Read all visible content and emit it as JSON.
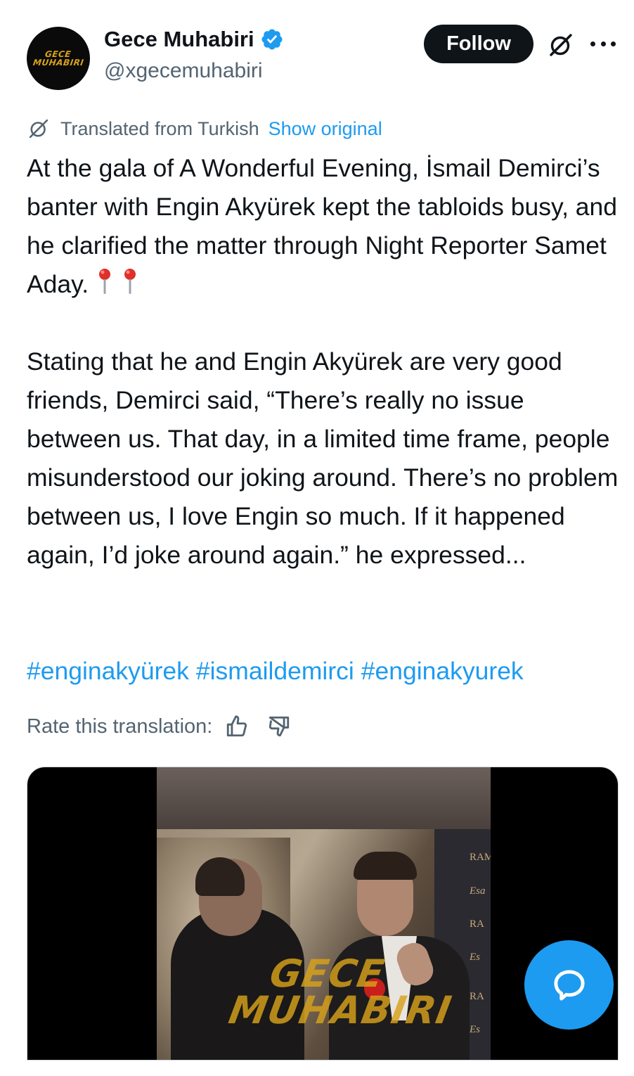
{
  "author": {
    "display_name": "Gece Muhabiri",
    "handle": "@xgecemuhabiri",
    "verified": true,
    "avatar_text": [
      "GECE",
      "MUHABIRI"
    ]
  },
  "header": {
    "follow_label": "Follow",
    "grok_icon": "grok-icon",
    "more_icon": "more-icon"
  },
  "translation": {
    "label": "Translated from Turkish",
    "show_original": "Show original",
    "rate_label": "Rate this translation:"
  },
  "post": {
    "paragraph1": "At the gala of A Wonderful Evening, İsmail Demirci’s banter with Engin Akyürek kept the tabloids busy, and he clarified the matter through Night Reporter Samet Aday.",
    "paragraph2": "Stating that he and Engin Akyürek are very good friends, Demirci said, “There’s really no issue between us. That day, in a limited time frame, people misunderstood our joking around. There’s no problem between us, I love Engin so much. If it happened again, I’d joke around again.” he expressed...",
    "hashtags": [
      "#enginakyürek",
      "#ismaildemirci",
      "#enginakyurek"
    ]
  },
  "media": {
    "watermark": [
      "GECE",
      "MUHABIRI"
    ],
    "backdrop_text": [
      "RAM",
      "Esa",
      "RA",
      "Es",
      "RA",
      "Es"
    ]
  },
  "colors": {
    "accent": "#1d9bf0",
    "text": "#0f1419",
    "muted": "#536471",
    "brand_gold": "#d8a21a"
  }
}
